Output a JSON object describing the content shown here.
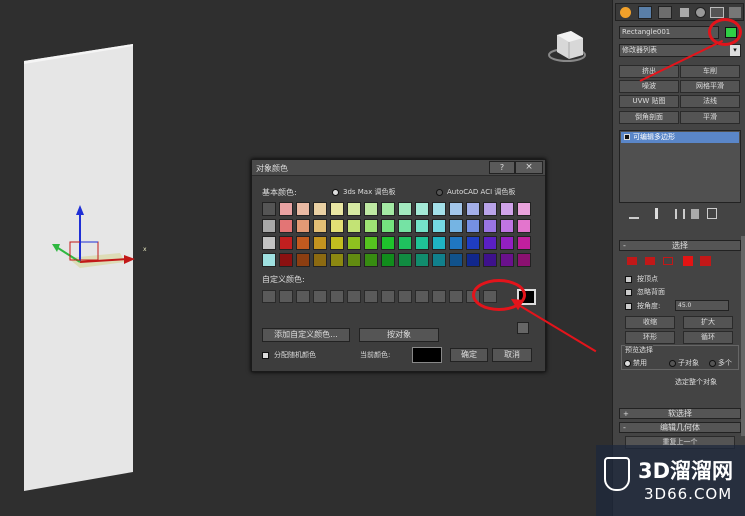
{
  "dialog": {
    "title": "对象颜色",
    "help_label": "?",
    "close_label": "×",
    "basic_colors_label": "基本颜色:",
    "palette_3dsmax": "3ds Max 调色板",
    "palette_autocad": "AutoCAD ACI 调色板",
    "custom_colors_label": "自定义颜色:",
    "add_custom_color_button": "添加自定义颜色...",
    "by_object_button": "按对象",
    "assign_random_colors": "分配随机颜色",
    "current_color_label": "当前颜色:",
    "ok_button": "确定",
    "cancel_button": "取消",
    "basic_colors": [
      [
        "#555555",
        "#e9a3a3",
        "#e9b9a3",
        "#e9d0a3",
        "#e9e6a3",
        "#d6e9a3",
        "#bfe9a3",
        "#a3e9a3",
        "#a3e9bf",
        "#a3e9d6",
        "#a3e0e9",
        "#a3c6e9",
        "#a3afe9",
        "#b9a3e9",
        "#d0a3e9",
        "#e9a3dc"
      ],
      [
        "#a8a8a8",
        "#e37575",
        "#e39a75",
        "#e3bf75",
        "#e3df75",
        "#c3e375",
        "#9ee375",
        "#75e37f",
        "#75e3a4",
        "#75e3c9",
        "#75d9e3",
        "#75b4e3",
        "#7590e3",
        "#9a75e3",
        "#bf75e3",
        "#e375cd"
      ],
      [
        "#c2c2c2",
        "#c21f1f",
        "#c25a1f",
        "#c2931f",
        "#c2bd1f",
        "#8ec21f",
        "#55c21f",
        "#1fc22c",
        "#1fc25e",
        "#1fc296",
        "#1fb3c2",
        "#1f76c2",
        "#1f3dc2",
        "#5a1fc2",
        "#931fc2",
        "#c21f9e"
      ],
      [
        "#9ee0e0",
        "#8c1111",
        "#8c3e11",
        "#8c6a11",
        "#8c8811",
        "#628c11",
        "#378c11",
        "#118c1c",
        "#118c41",
        "#118c6d",
        "#11808c",
        "#11528c",
        "#11278c",
        "#3e118c",
        "#6a118c",
        "#8c1171"
      ]
    ],
    "custom_colors_count": 14,
    "current_color": "#000000",
    "selected_custom_color": "#000000"
  },
  "panel": {
    "object_name": "Rectangle001",
    "object_color": "#2fcf45",
    "modifier_list_label": "修改器列表",
    "modifier_buttons": [
      [
        "挤出",
        "车削"
      ],
      [
        "噪波",
        "网格平滑"
      ],
      [
        "UVW 贴图",
        "法线"
      ],
      [
        "倒角剖面",
        "平滑"
      ]
    ],
    "stack_item": "可编辑多边形",
    "selection_rollout": "选择",
    "by_vertex": "按顶点",
    "ignore_backfacing": "忽略背面",
    "by_angle": "按角度:",
    "by_angle_value": "45.0",
    "shrink": "收缩",
    "grow": "扩大",
    "ring": "环形",
    "loop": "循环",
    "preview_selection": "预览选择",
    "preview_disabled": "禁用",
    "preview_subobject": "子对象",
    "preview_multi": "多个",
    "select_whole_object": "选定整个对象",
    "soft_selection_rollout": "软选择",
    "edit_geometry_rollout": "编辑几何体",
    "repeat_last": "重复上一个"
  },
  "watermark": {
    "brand": "3D溜溜网",
    "url": "3D66.COM"
  },
  "viewport": {
    "axis_x_label": "x"
  }
}
